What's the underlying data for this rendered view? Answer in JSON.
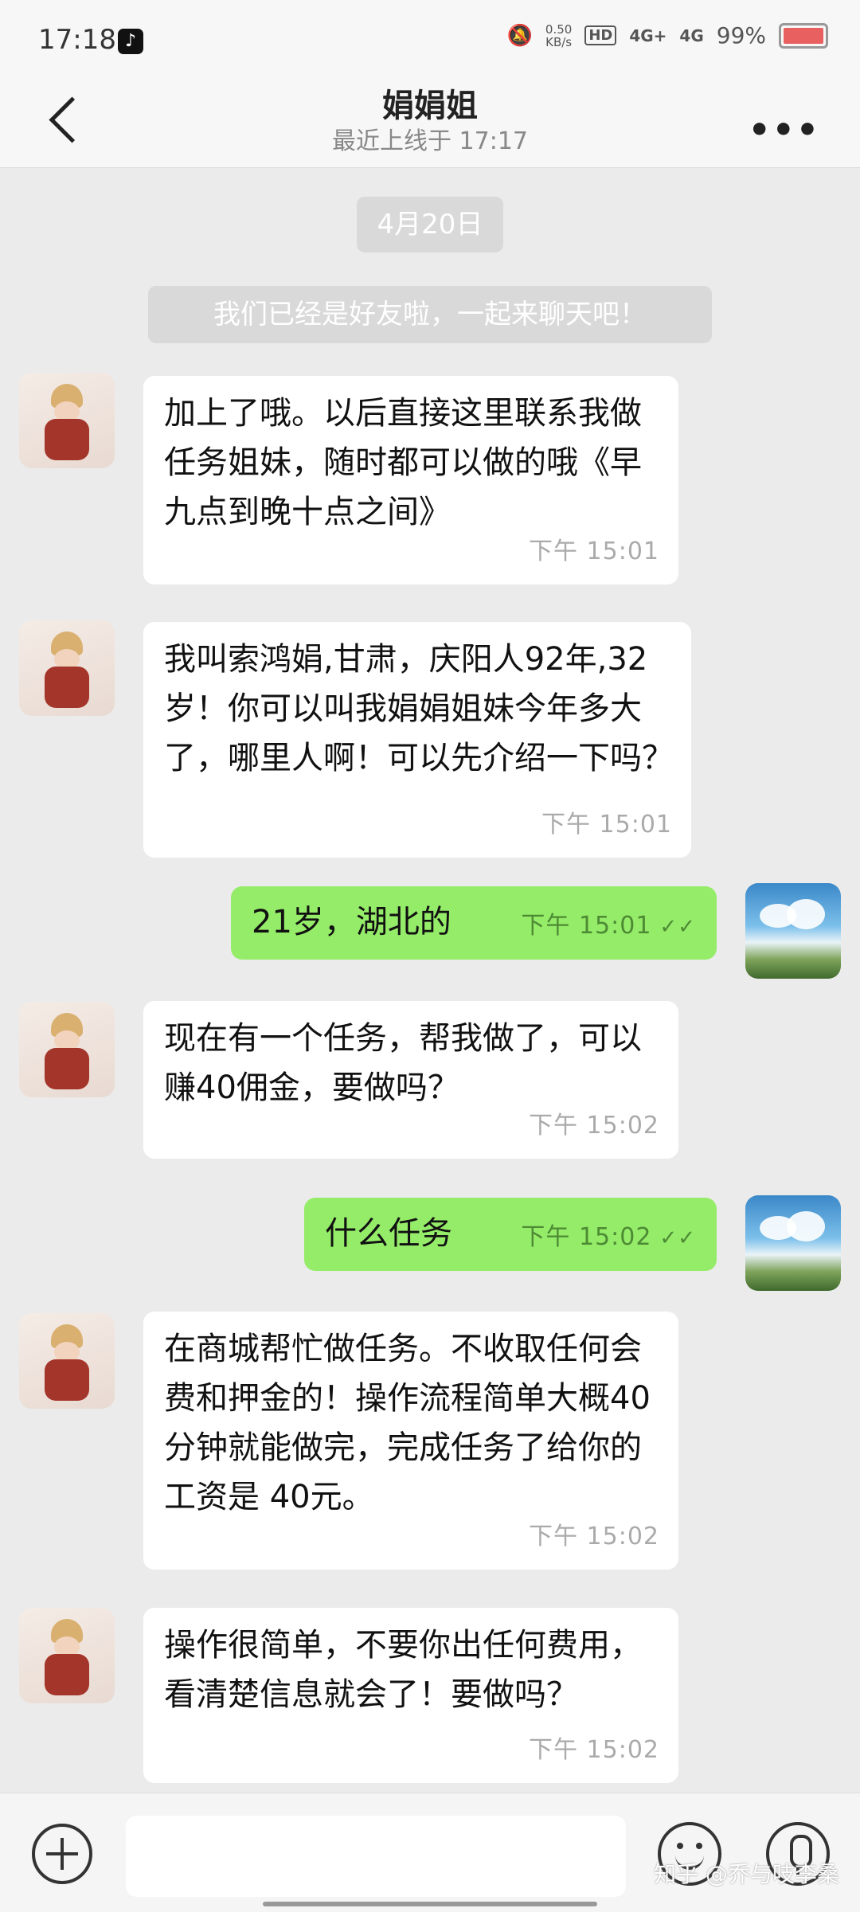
{
  "status_bar": {
    "time": "17:18",
    "net_speed": "0.50",
    "net_unit": "KB/s",
    "hd": "HD",
    "sig1": "4G+",
    "sig2": "4G",
    "battery": "99%"
  },
  "header": {
    "title": "娟娟姐",
    "subtitle": "最近上线于 17:17"
  },
  "chat": {
    "date": "4月20日",
    "system_notice": "我们已经是好友啦，一起来聊天吧！",
    "messages": [
      {
        "side": "in",
        "text": "加上了哦。以后直接这里联系我做任务姐妹，随时都可以做的哦《早九点到晚十点之间》",
        "time": "下午  15:01"
      },
      {
        "side": "in",
        "text": "我叫索鸿娟,甘肃，庆阳人92年,32岁！你可以叫我娟娟姐妹今年多大了，哪里人啊！可以先介绍一下吗？",
        "time": "下午  15:01"
      },
      {
        "side": "out",
        "text": "21岁，湖北的",
        "time": "下午  15:01"
      },
      {
        "side": "in",
        "text": "现在有一个任务，帮我做了，可以赚40佣金，要做吗？",
        "time": "下午  15:02"
      },
      {
        "side": "out",
        "text": "什么任务",
        "time": "下午  15:02"
      },
      {
        "side": "in",
        "text": "在商城帮忙做任务。不收取任何会费和押金的！操作流程简单大概40分钟就能做完，完成任务了给你的工资是 40元。",
        "time": "下午  15:02"
      },
      {
        "side": "in",
        "text": "操作很简单，不要你出任何费用，看清楚信息就会了！要做吗？",
        "time": "下午  15:02"
      }
    ]
  },
  "input_bar": {
    "placeholder": "",
    "watermark": "知乎 @乔与吱李桑"
  },
  "icons": {
    "back": "chevron-left-icon",
    "more": "more-dots-icon",
    "plus": "plus-circle-icon",
    "emoji": "emoji-icon",
    "voice": "microphone-icon",
    "read": "double-check-icon"
  },
  "colors": {
    "outgoing_bubble": "#95ec69",
    "incoming_bubble": "#ffffff",
    "chat_background": "#ebebeb"
  }
}
